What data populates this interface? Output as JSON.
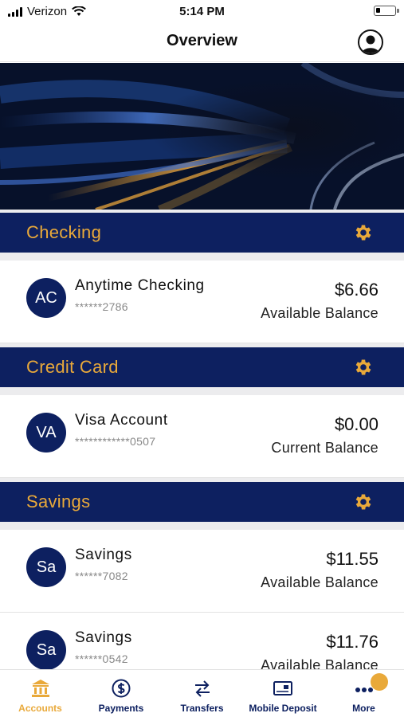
{
  "status_bar": {
    "carrier": "Verizon",
    "time": "5:14 PM"
  },
  "header": {
    "title": "Overview",
    "profile_icon": "user-profile-icon"
  },
  "colors": {
    "navy": "#0d2060",
    "gold": "#e9a93a"
  },
  "sections": [
    {
      "title": "Checking",
      "accounts": [
        {
          "initials": "AC",
          "name": "Anytime Checking",
          "number": "******2786",
          "balance": "$6.66",
          "balance_label": "Available Balance"
        }
      ]
    },
    {
      "title": "Credit Card",
      "accounts": [
        {
          "initials": "VA",
          "name": "Visa Account",
          "number": "************0507",
          "balance": "$0.00",
          "balance_label": "Current Balance"
        }
      ]
    },
    {
      "title": "Savings",
      "accounts": [
        {
          "initials": "Sa",
          "name": "Savings",
          "number": "******7082",
          "balance": "$11.55",
          "balance_label": "Available Balance"
        },
        {
          "initials": "Sa",
          "name": "Savings",
          "number": "******0542",
          "balance": "$11.76",
          "balance_label": "Available Balance"
        }
      ]
    }
  ],
  "tabs": [
    {
      "label": "Accounts",
      "icon": "bank-icon",
      "active": true
    },
    {
      "label": "Payments",
      "icon": "dollar-cycle-icon",
      "active": false
    },
    {
      "label": "Transfers",
      "icon": "transfer-arrows-icon",
      "active": false
    },
    {
      "label": "Mobile Deposit",
      "icon": "check-deposit-icon",
      "active": false
    },
    {
      "label": "More",
      "icon": "more-dots-icon",
      "active": false
    }
  ]
}
